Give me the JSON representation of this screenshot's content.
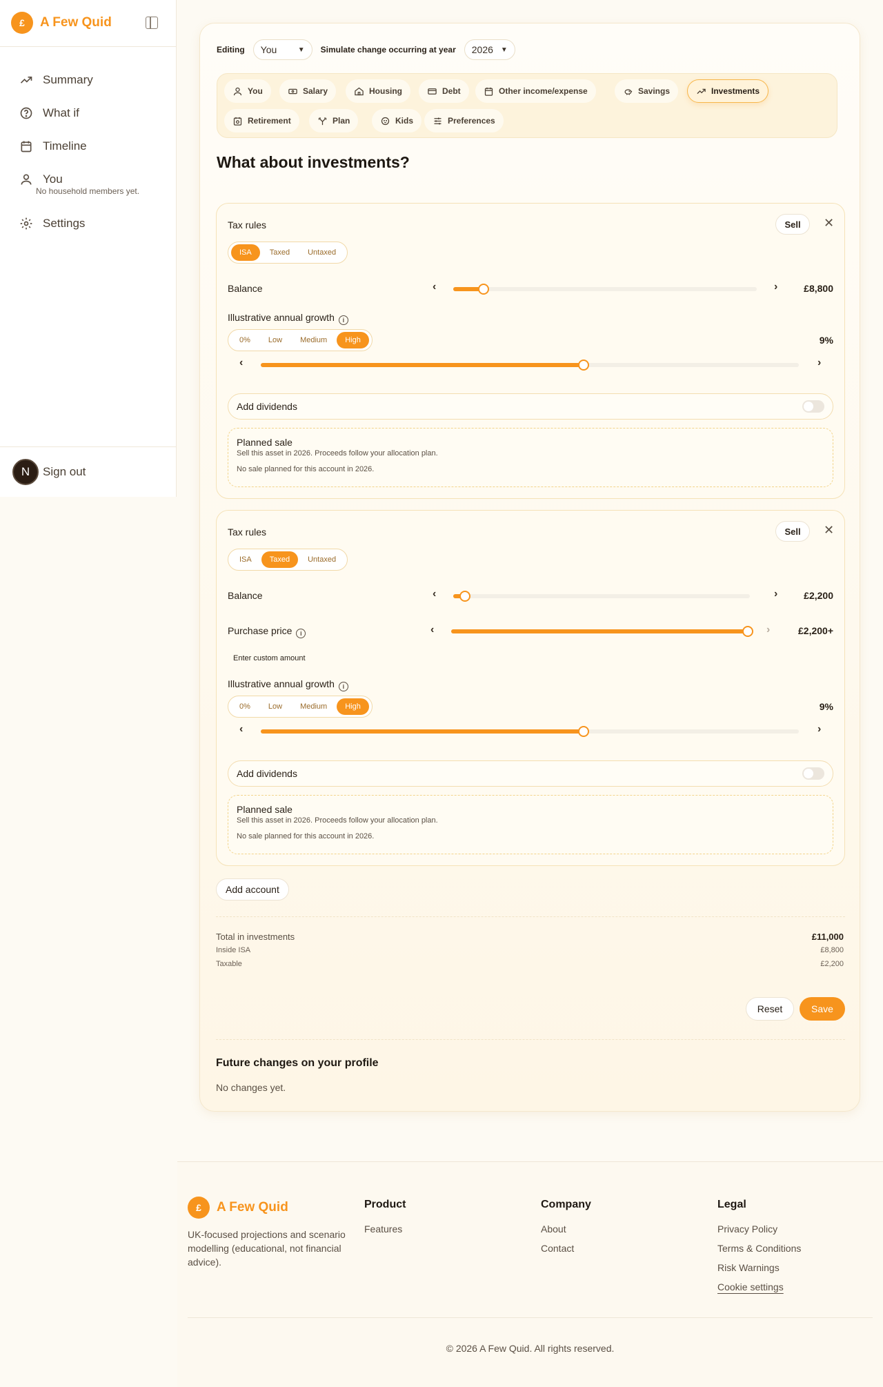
{
  "brand": {
    "name": "A Few Quid",
    "logo_char": "£"
  },
  "sidebar": {
    "items": [
      {
        "label": "Summary",
        "icon": "trending-up-icon"
      },
      {
        "label": "What if",
        "icon": "help-circle-icon"
      },
      {
        "label": "Timeline",
        "icon": "calendar-icon"
      },
      {
        "label": "You",
        "icon": "user-icon"
      }
    ],
    "household_note": "No household members yet.",
    "settings_label": "Settings",
    "avatar_initial": "N",
    "sign_out": "Sign out"
  },
  "editor": {
    "editing_label": "Editing",
    "editing_value": "You",
    "simulate_label": "Simulate change occurring at year",
    "year_value": "2026"
  },
  "tabs": [
    {
      "label": "You",
      "icon": "user-icon"
    },
    {
      "label": "Salary",
      "icon": "banknote-icon"
    },
    {
      "label": "Housing",
      "icon": "home-icon"
    },
    {
      "label": "Debt",
      "icon": "credit-card-icon"
    },
    {
      "label": "Other income/expense",
      "icon": "calendar-icon"
    },
    {
      "label": "Savings",
      "icon": "piggy-bank-icon"
    },
    {
      "label": "Investments",
      "icon": "trending-up-icon",
      "active": true
    },
    {
      "label": "Retirement",
      "icon": "calendar-clock-icon"
    },
    {
      "label": "Plan",
      "icon": "split-icon"
    },
    {
      "label": "Kids",
      "icon": "baby-icon"
    },
    {
      "label": "Preferences",
      "icon": "sliders-icon"
    }
  ],
  "page_title": "What about investments?",
  "accounts": [
    {
      "tax_rules_label": "Tax rules",
      "sell_label": "Sell",
      "tax_options": [
        "ISA",
        "Taxed",
        "Untaxed"
      ],
      "tax_selected": "ISA",
      "balance_label": "Balance",
      "balance_value": "£8,800",
      "balance_fraction": 0.1,
      "growth_label": "Illustrative annual growth",
      "growth_options": [
        "0%",
        "Low",
        "Medium",
        "High"
      ],
      "growth_selected": "High",
      "growth_value": "9%",
      "growth_fraction": 0.6,
      "dividends_label": "Add dividends",
      "dividends_on": false,
      "planned_title": "Planned sale",
      "planned_desc": "Sell this asset in 2026. Proceeds follow your allocation plan.",
      "planned_note": "No sale planned for this account in 2026."
    },
    {
      "tax_rules_label": "Tax rules",
      "sell_label": "Sell",
      "tax_options": [
        "ISA",
        "Taxed",
        "Untaxed"
      ],
      "tax_selected": "Taxed",
      "balance_label": "Balance",
      "balance_value": "£2,200",
      "balance_fraction": 0.04,
      "purchase_label": "Purchase price",
      "purchase_value": "£2,200+",
      "purchase_fraction": 1.0,
      "custom_amount_label": "Enter custom amount",
      "growth_label": "Illustrative annual growth",
      "growth_options": [
        "0%",
        "Low",
        "Medium",
        "High"
      ],
      "growth_selected": "High",
      "growth_value": "9%",
      "growth_fraction": 0.6,
      "dividends_label": "Add dividends",
      "dividends_on": false,
      "planned_title": "Planned sale",
      "planned_desc": "Sell this asset in 2026. Proceeds follow your allocation plan.",
      "planned_note": "No sale planned for this account in 2026."
    }
  ],
  "add_account_label": "Add account",
  "totals": {
    "total_label": "Total in investments",
    "total_value": "£11,000",
    "isa_label": "Inside ISA",
    "isa_value": "£8,800",
    "taxable_label": "Taxable",
    "taxable_value": "£2,200"
  },
  "actions": {
    "reset": "Reset",
    "save": "Save"
  },
  "future": {
    "title": "Future changes on your profile",
    "empty": "No changes yet."
  },
  "footer": {
    "description": "UK-focused projections and scenario modelling (educational, not financial advice).",
    "product": {
      "heading": "Product",
      "links": [
        "Features"
      ]
    },
    "company": {
      "heading": "Company",
      "links": [
        "About",
        "Contact"
      ]
    },
    "legal": {
      "heading": "Legal",
      "links": [
        "Privacy Policy",
        "Terms & Conditions",
        "Risk Warnings",
        "Cookie settings"
      ]
    },
    "copyright": "© 2026 A Few Quid. All rights reserved."
  },
  "colors": {
    "accent": "#f7941d",
    "background": "#fdfaf3"
  }
}
